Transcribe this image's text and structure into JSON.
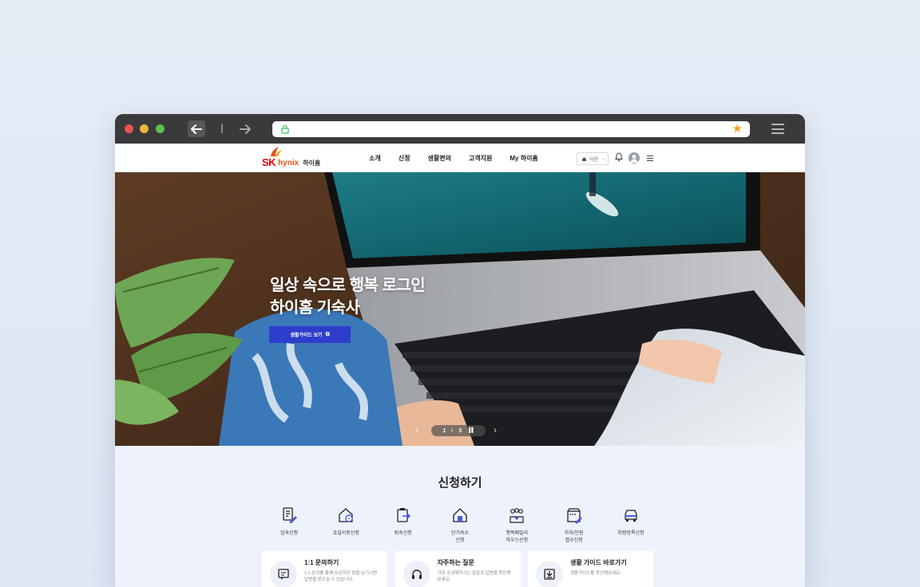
{
  "browser": {
    "url": ""
  },
  "header": {
    "logo_sk": "SK",
    "logo_hynix": "hynix",
    "logo_home": "하이홈",
    "nav": [
      "소개",
      "신청",
      "생활편의",
      "고객지원",
      "My 하이홈"
    ],
    "lang_label": "이천"
  },
  "hero": {
    "title_line1": "일상 속으로 행복 로그인",
    "title_line2": "하이홈 기숙사",
    "cta_label": "생활가이드 보기",
    "pager_current": "1",
    "pager_total": "3"
  },
  "apply": {
    "title": "신청하기",
    "services": [
      {
        "label": "입숙신청",
        "icon": "document-pen-icon"
      },
      {
        "label": "호실이동신청",
        "icon": "house-refresh-icon"
      },
      {
        "label": "퇴숙신청",
        "icon": "clipboard-exit-icon"
      },
      {
        "label": "단기숙소\n신청",
        "icon": "house-short-stay-icon"
      },
      {
        "label": "행복패밀리\n하우스신청",
        "icon": "family-house-icon"
      },
      {
        "label": "하자/민원\n접수신청",
        "icon": "repair-report-icon"
      },
      {
        "label": "차량등록신청",
        "icon": "car-icon"
      }
    ],
    "cards": [
      {
        "title": "1:1 문의하기",
        "desc": "1:1 문의를 통해 궁금하신 점을 남기시면 답변을 받으실 수 있습니다.",
        "icon": "chat-icon"
      },
      {
        "title": "자주하는 질문",
        "desc": "가장 궁금해하시는 질문과 답변을 확인해보세요.",
        "icon": "headset-icon"
      },
      {
        "title": "생활 가이드 바로가기",
        "desc": "생활가이드를 확인해보세요.",
        "icon": "download-icon"
      }
    ]
  },
  "colors": {
    "accent": "#2f3dcc",
    "brand_red": "#e60012",
    "apply_bg": "#eef2fd"
  }
}
